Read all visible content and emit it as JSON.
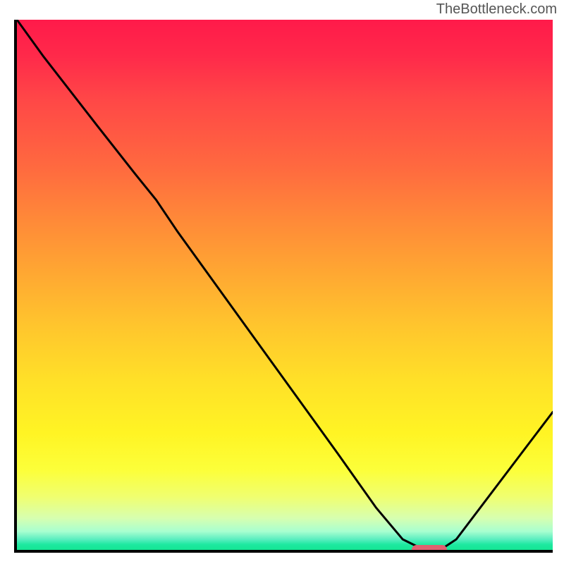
{
  "watermark": "TheBottleneck.com",
  "chart_data": {
    "type": "line",
    "title": "",
    "xlabel": "",
    "ylabel": "",
    "xlim": [
      0,
      100
    ],
    "ylim": [
      0,
      100
    ],
    "grid": false,
    "series": [
      {
        "name": "curve",
        "x": [
          0,
          5,
          15,
          22,
          26,
          30,
          40,
          50,
          60,
          67,
          72,
          76,
          79,
          82,
          88,
          94,
          100
        ],
        "values": [
          100,
          93,
          80,
          71,
          66,
          60,
          46,
          32,
          18,
          8,
          2,
          0,
          0,
          2,
          10,
          18,
          26
        ]
      }
    ],
    "marker": {
      "x_center": 77,
      "y": 0,
      "width_pct": 6.6
    },
    "background_gradient": {
      "top": "#ff1a4a",
      "mid": "#ffc62d",
      "bottom": "#15e593"
    }
  }
}
